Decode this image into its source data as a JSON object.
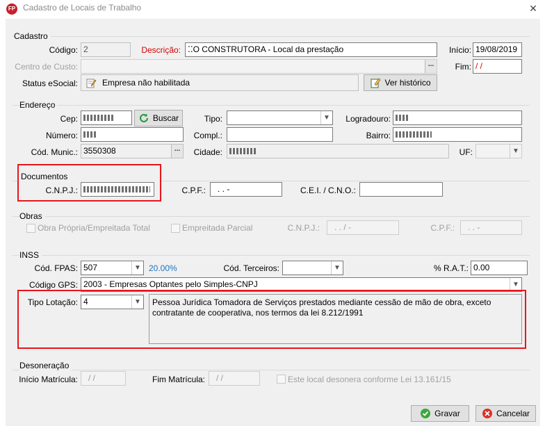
{
  "window": {
    "title": "Cadastro de Locais de Trabalho",
    "app_icon_text": "FP",
    "close_glyph": "✕"
  },
  "cadastro": {
    "group_title": "Cadastro",
    "codigo_label": "Código:",
    "codigo_value": "2",
    "descricao_label": "Descrição:",
    "descricao_value": "⁚⁚O CONSTRUTORA - Local da prestação",
    "inicio_label": "Início:",
    "inicio_value": "19/08/2019",
    "centro_label": "Centro de Custo:",
    "centro_value": "",
    "fim_label": "Fim:",
    "fim_value": "/ /",
    "status_label": "Status eSocial:",
    "status_value": "Empresa não habilitada",
    "historico_button": "Ver histórico",
    "ellipsis": "..."
  },
  "endereco": {
    "group_title": "Endereço",
    "cep_label": "Cep:",
    "cep_value": "",
    "buscar_button": "Buscar",
    "tipo_label": "Tipo:",
    "tipo_value": "",
    "logradouro_label": "Logradouro:",
    "logradouro_value": "",
    "numero_label": "Número:",
    "numero_value": "",
    "compl_label": "Compl.:",
    "compl_value": "",
    "bairro_label": "Bairro:",
    "bairro_value": "",
    "codmunic_label": "Cód. Munic.:",
    "codmunic_value": "3550308",
    "cidade_label": "Cidade:",
    "cidade_value": "",
    "uf_label": "UF:",
    "uf_value": "",
    "ellipsis": "..."
  },
  "documentos": {
    "group_title": "Documentos",
    "cnpj_label": "C.N.P.J.:",
    "cnpj_value": "",
    "cpf_label": "C.P.F.:",
    "cpf_value": ".  .  -",
    "cei_label": "C.E.I. / C.N.O.:",
    "cei_value": ""
  },
  "obras": {
    "group_title": "Obras",
    "obra_propria_label": "Obra Própria/Empreitada Total",
    "empreitada_parcial_label": "Empreitada Parcial",
    "cnpj_label": "C.N.P.J.:",
    "cnpj_value": ".  .  /  -",
    "cpf_label": "C.P.F.:",
    "cpf_value": ".  .  -"
  },
  "inss": {
    "group_title": "INSS",
    "fpas_label": "Cód. FPAS:",
    "fpas_value": "507",
    "fpas_percent": "20.00%",
    "terceiros_label": "Cód. Terceiros:",
    "terceiros_value": "",
    "rat_label": "% R.A.T.:",
    "rat_value": "0.00",
    "gps_label": "Código GPS:",
    "gps_value": "2003  - Empresas Optantes pelo Simples-CNPJ",
    "lotacao_label": "Tipo Lotação:",
    "lotacao_value": "4",
    "lotacao_desc": "Pessoa Jurídica Tomadora de Serviços prestados mediante cessão de mão de obra, exceto contratante de cooperativa, nos termos da lei 8.212/1991"
  },
  "desoneracao": {
    "group_title": "Desoneração",
    "inicio_label": "Início Matrícula:",
    "inicio_value": "/ /",
    "fim_label": "Fim Matrícula:",
    "fim_value": "/ /",
    "check_label": "Este local desonera conforme Lei 13.161/15"
  },
  "footer": {
    "gravar_button": "Gravar",
    "cancelar_button": "Cancelar"
  },
  "colors": {
    "highlight_frame": "#e8141c",
    "percent_text": "#1e73be",
    "required_label": "#d40000"
  }
}
